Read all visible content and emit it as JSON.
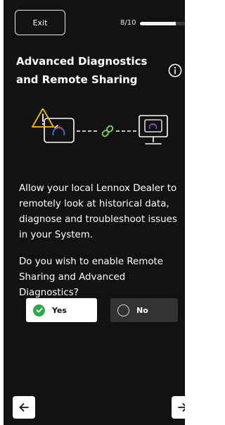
{
  "header": {
    "exit_label": "Exit",
    "progress_text": "8/10",
    "progress_fraction": 0.8
  },
  "title": {
    "line1": "Advanced Diagnostics",
    "line2": "and Remote Sharing"
  },
  "icons": {
    "info": "info-icon",
    "warning": "warning-icon",
    "thermostat": "thermostat-icon",
    "link": "link-icon",
    "monitor": "monitor-icon",
    "check": "check-icon",
    "back": "arrow-left-icon",
    "next": "arrow-right-icon"
  },
  "colors": {
    "background": "#121212",
    "warning": "#f2c200",
    "link": "#7ed957",
    "check": "#2ea84e",
    "accent_red": "#e53935",
    "accent_blue": "#2f6fe0"
  },
  "body_text": "Allow your local Lennox Dealer to remotely look at historical data, diagnose and troubleshoot issues in your System.",
  "question": "Do you wish to enable Remote Sharing and Advanced Diagnostics?",
  "options": {
    "yes_label": "Yes",
    "no_label": "No",
    "selected": "Yes"
  }
}
